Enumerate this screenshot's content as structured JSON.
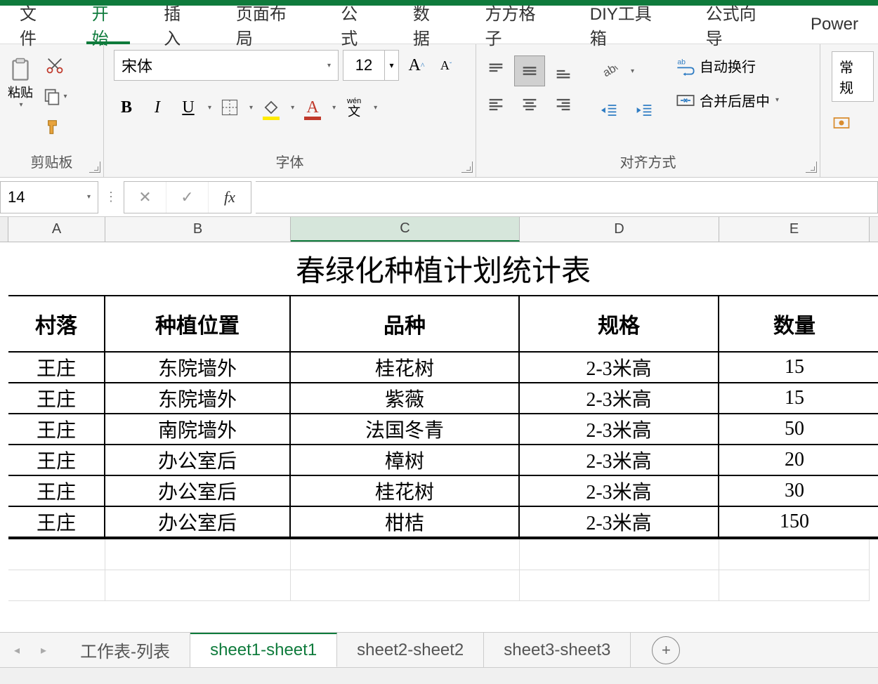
{
  "menubar": {
    "items": [
      "文件",
      "开始",
      "插入",
      "页面布局",
      "公式",
      "数据",
      "方方格子",
      "DIY工具箱",
      "公式向导",
      "Power"
    ],
    "active_index": 1
  },
  "ribbon": {
    "clipboard": {
      "label": "剪贴板",
      "paste_label": "粘贴"
    },
    "font": {
      "label": "字体",
      "name": "宋体",
      "size": "12",
      "grow": "A",
      "shrink": "A",
      "bold": "B",
      "italic": "I",
      "underline": "U",
      "pinyin": "wén"
    },
    "align": {
      "label": "对齐方式",
      "wrap": "自动换行",
      "merge": "合并后居中"
    },
    "number": {
      "fmt": "常规"
    }
  },
  "formula_bar": {
    "cell_ref": "14",
    "cancel": "✕",
    "confirm": "✓",
    "fx": "fx",
    "value": ""
  },
  "columns": [
    "A",
    "B",
    "C",
    "D",
    "E"
  ],
  "selected_col_index": 2,
  "sheet": {
    "title": "春绿化种植计划统计表",
    "headers": [
      "村落",
      "种植位置",
      "品种",
      "规格",
      "数量"
    ],
    "rows": [
      [
        "王庄",
        "东院墙外",
        "桂花树",
        "2-3米高",
        "15"
      ],
      [
        "王庄",
        "东院墙外",
        "紫薇",
        "2-3米高",
        "15"
      ],
      [
        "王庄",
        "南院墙外",
        "法国冬青",
        "2-3米高",
        "50"
      ],
      [
        "王庄",
        "办公室后",
        "樟树",
        "2-3米高",
        "20"
      ],
      [
        "王庄",
        "办公室后",
        "桂花树",
        "2-3米高",
        "30"
      ],
      [
        "王庄",
        "办公室后",
        "柑桔",
        "2-3米高",
        "150"
      ]
    ]
  },
  "tabs": {
    "items": [
      "工作表-列表",
      "sheet1-sheet1",
      "sheet2-sheet2",
      "sheet3-sheet3"
    ],
    "active_index": 1
  }
}
